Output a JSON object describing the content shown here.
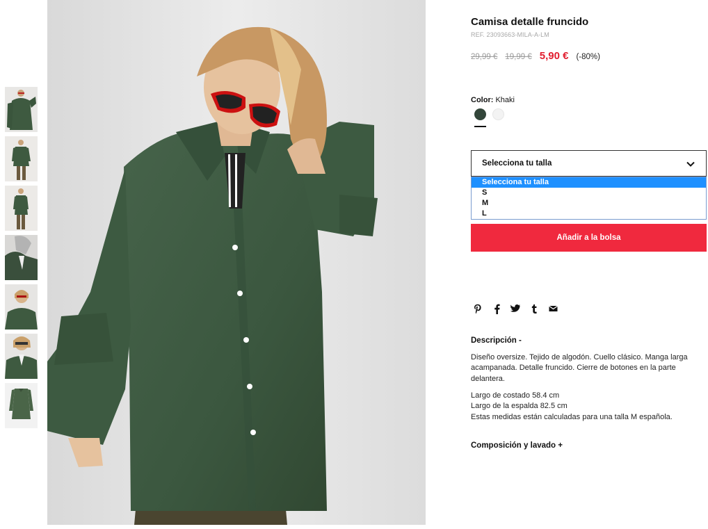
{
  "product": {
    "title": "Camisa detalle fruncido",
    "ref": "REF. 23093663-MILA-A-LM",
    "prices": {
      "original": "29,99 €",
      "previous": "19,99 €",
      "current": "5,90 €",
      "discount": "(-80%)"
    }
  },
  "color": {
    "label": "Color:",
    "value": "Khaki",
    "swatches": [
      {
        "name": "Khaki",
        "hex": "#33463a",
        "selected": true
      },
      {
        "name": "White",
        "hex": "#f3f3f3",
        "selected": false
      }
    ]
  },
  "size": {
    "selected": "Selecciona tu talla",
    "options": [
      "Selecciona tu talla",
      "S",
      "M",
      "L"
    ],
    "highlighted_index": 0
  },
  "add_to_bag": "Añadir a la bolsa",
  "social": [
    {
      "icon": "pinterest-icon"
    },
    {
      "icon": "facebook-icon"
    },
    {
      "icon": "twitter-icon"
    },
    {
      "icon": "tumblr-icon"
    },
    {
      "icon": "email-icon"
    }
  ],
  "description": {
    "title": "Descripción -",
    "text": "Diseño oversize. Tejido de algodón. Cuello clásico. Manga larga acampanada. Detalle fruncido. Cierre de botones en la parte delantera.",
    "measures": [
      "Largo de costado 58.4 cm",
      "Largo de la espalda 82.5 cm",
      "Estas medidas están calculadas para una talla M española."
    ]
  },
  "composition_title": "Composición y lavado +",
  "colors": {
    "accent_red": "#e11d2e",
    "button_red": "#f0293e",
    "shirt_khaki": "#3f5a41",
    "select_highlight": "#1e90ff"
  }
}
